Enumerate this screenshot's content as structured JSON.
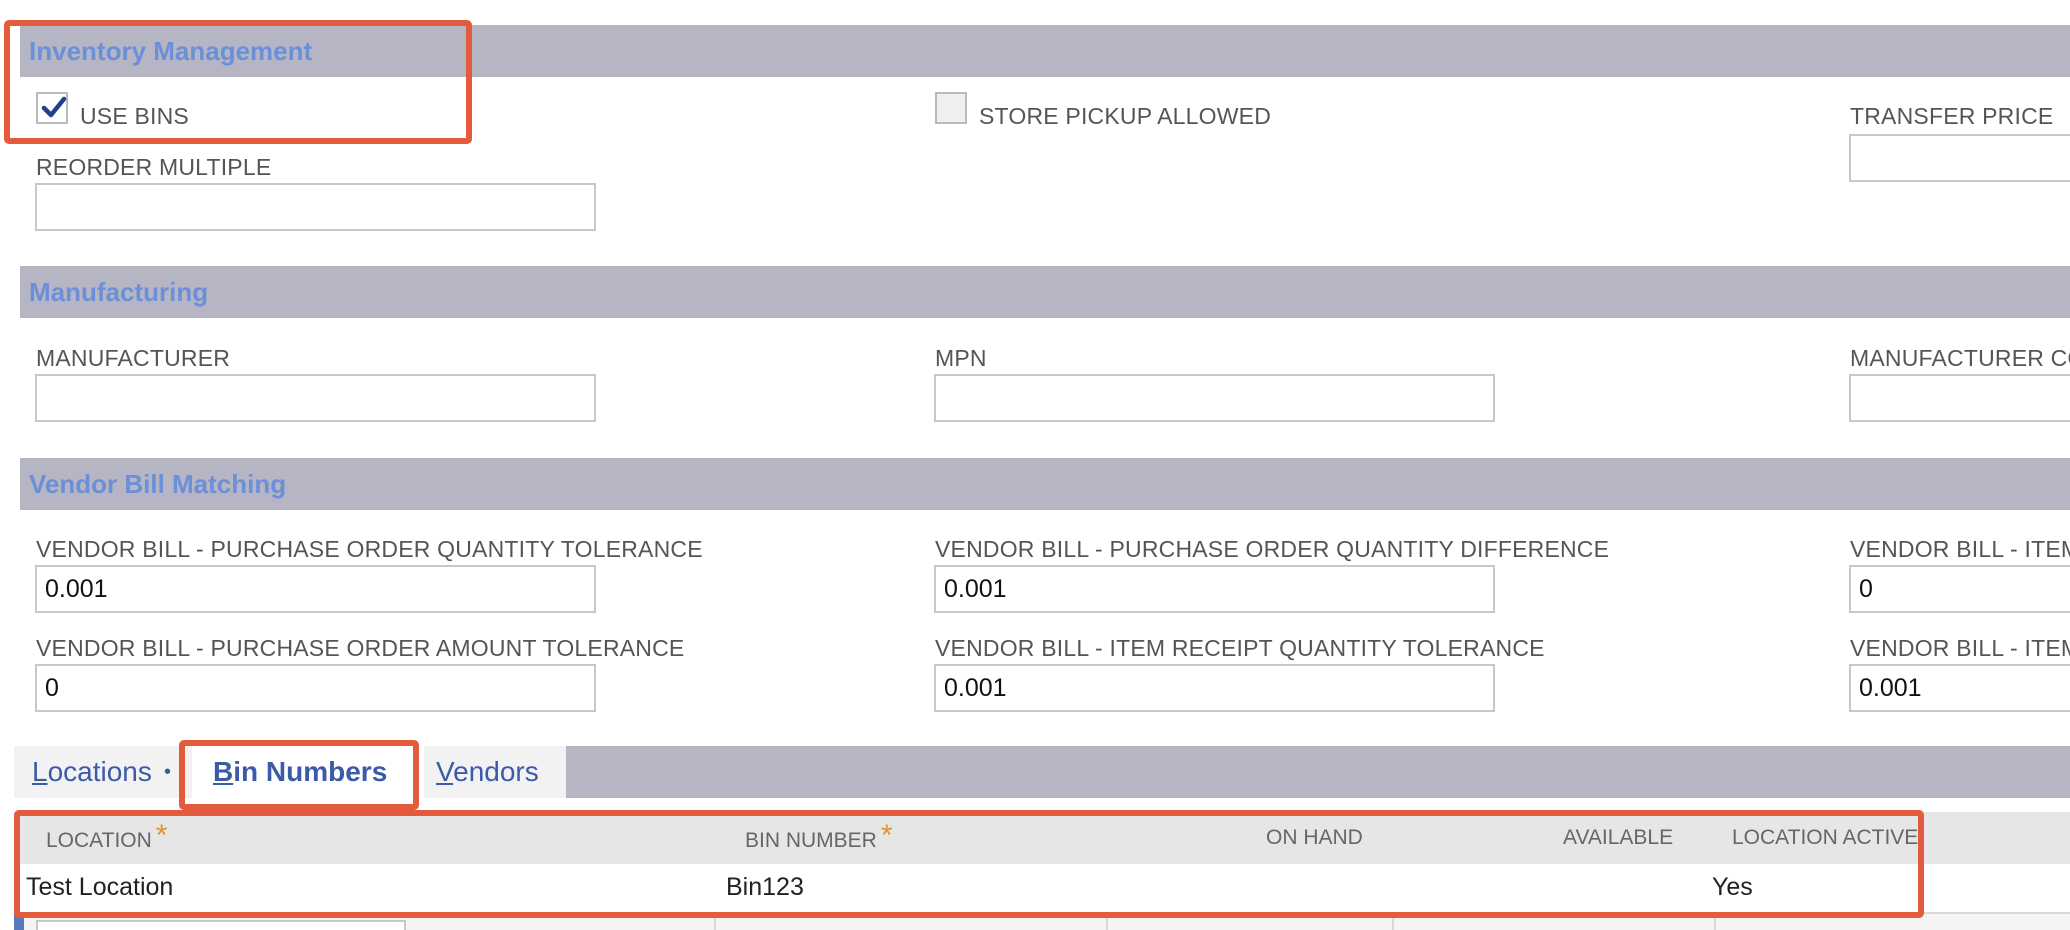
{
  "sections": {
    "inventory": {
      "title": "Inventory Management",
      "use_bins": {
        "label": "USE BINS",
        "checked": true
      },
      "store_pickup": {
        "label": "STORE PICKUP ALLOWED",
        "checked": false
      },
      "transfer_price": {
        "label": "TRANSFER PRICE",
        "value": ""
      },
      "reorder_multiple": {
        "label": "REORDER MULTIPLE",
        "value": ""
      }
    },
    "manufacturing": {
      "title": "Manufacturing",
      "manufacturer": {
        "label": "MANUFACTURER",
        "value": ""
      },
      "mpn": {
        "label": "MPN",
        "value": ""
      },
      "manufacturer_country": {
        "label": "MANUFACTURER CO",
        "value": ""
      }
    },
    "vendor_bill": {
      "title": "Vendor Bill Matching",
      "po_qty_tolerance": {
        "label": "VENDOR BILL - PURCHASE ORDER QUANTITY TOLERANCE",
        "value": "0.001"
      },
      "po_qty_difference": {
        "label": "VENDOR BILL - PURCHASE ORDER QUANTITY DIFFERENCE",
        "value": "0.001"
      },
      "item_field_1": {
        "label": "VENDOR BILL - ITEM",
        "value": "0"
      },
      "po_amount_tolerance": {
        "label": "VENDOR BILL - PURCHASE ORDER AMOUNT TOLERANCE",
        "value": "0"
      },
      "ir_qty_tolerance": {
        "label": "VENDOR BILL - ITEM RECEIPT QUANTITY TOLERANCE",
        "value": "0.001"
      },
      "item_field_2": {
        "label": "VENDOR BILL - ITEM",
        "value": "0.001"
      }
    }
  },
  "tabs": {
    "locations": {
      "key": "L",
      "rest": "ocations",
      "dot": "•"
    },
    "bin_numbers": {
      "key": "B",
      "rest": "in Numbers"
    },
    "vendors": {
      "key": "V",
      "rest": "endors"
    }
  },
  "bin_table": {
    "columns": {
      "location": "LOCATION",
      "bin_number": "BIN NUMBER",
      "on_hand": "ON HAND",
      "available": "AVAILABLE",
      "location_active": "LOCATION ACTIVE"
    },
    "required_marker": "*",
    "rows": [
      {
        "location": "Test Location",
        "bin_number": "Bin123",
        "on_hand": "",
        "available": "",
        "location_active": "Yes"
      }
    ]
  },
  "colors": {
    "section_bar": "#b5b5c4",
    "section_title": "#6b8fd8",
    "tab_text": "#3b5aa8",
    "annotation": "#e45a3c",
    "required_star": "#e0942a"
  }
}
